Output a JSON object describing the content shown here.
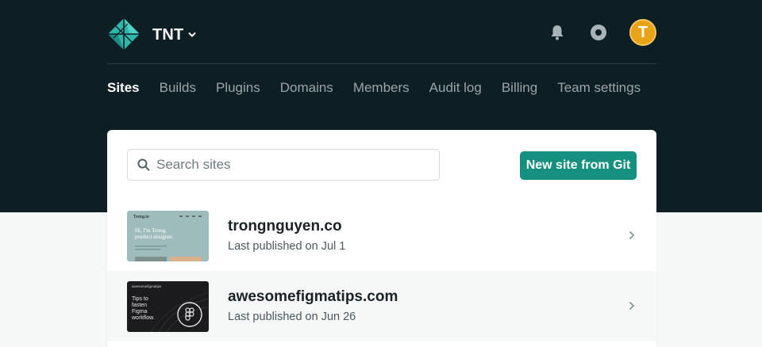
{
  "header": {
    "team_name": "TNT",
    "avatar_initial": "T",
    "icons": [
      "netlify-logo-icon",
      "chevron-down-icon",
      "bell-icon",
      "settings-icon"
    ],
    "colors": {
      "background": "#0e1e25",
      "avatar": "#e8a317",
      "accent": "#15907f"
    }
  },
  "nav": {
    "items": [
      {
        "label": "Sites",
        "active": true
      },
      {
        "label": "Builds"
      },
      {
        "label": "Plugins"
      },
      {
        "label": "Domains"
      },
      {
        "label": "Members"
      },
      {
        "label": "Audit log"
      },
      {
        "label": "Billing"
      },
      {
        "label": "Team settings"
      }
    ]
  },
  "sites_panel": {
    "search": {
      "placeholder": "Search sites",
      "value": ""
    },
    "new_site_label": "New site from Git",
    "sites": [
      {
        "name": "trongnguyen.co",
        "meta": "Last published on Jul 1",
        "thumbnail": {
          "brand": "Trong.io",
          "headline_line1": "Hi, I'm Trong,",
          "headline_line2": "product designer."
        }
      },
      {
        "name": "awesomefigmatips.com",
        "meta": "Last published on Jun 26",
        "thumbnail": {
          "brand": "awesomefigmatips",
          "headline_line1": "Tips to",
          "headline_line2": "fasten",
          "headline_line3": "Figma",
          "headline_line4": "workflow."
        }
      }
    ]
  }
}
